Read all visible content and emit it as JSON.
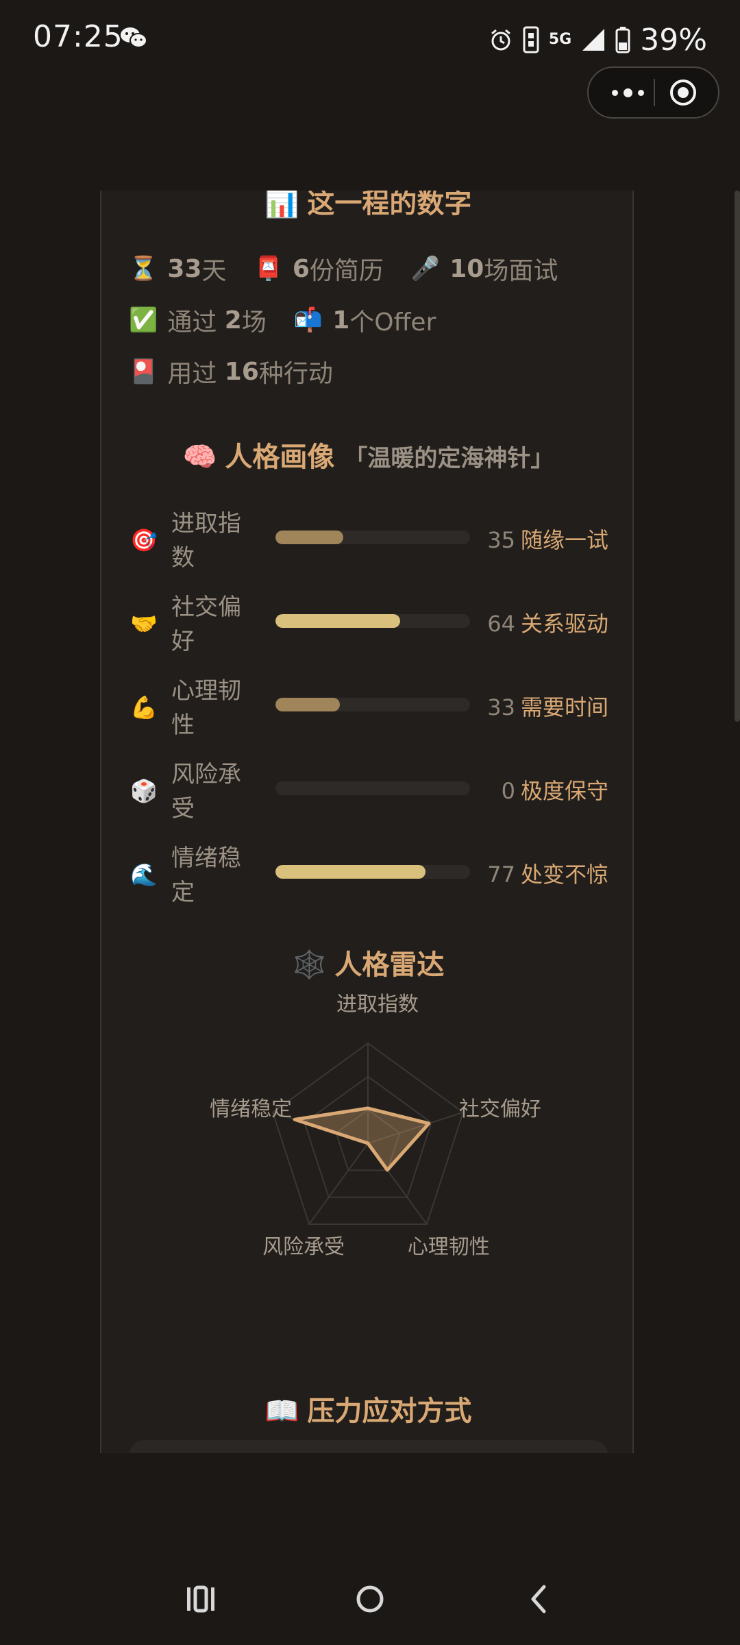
{
  "status_bar": {
    "time": "07:25",
    "network": "5G",
    "battery": "39%"
  },
  "capsule": {
    "more_icon": "more-dots-icon",
    "close_icon": "target-close-icon"
  },
  "stats": {
    "title_emoji": "📊",
    "title": "这一程的数字",
    "items": [
      {
        "emoji": "⏳",
        "value": "33",
        "unit": "天"
      },
      {
        "emoji": "📮",
        "value": "6",
        "unit": "份简历"
      },
      {
        "emoji": "🎤",
        "value": "10",
        "unit": "场面试"
      },
      {
        "emoji": "✅",
        "prefix": "通过 ",
        "value": "2",
        "unit": "场"
      },
      {
        "emoji": "📬",
        "value": "1",
        "unit": "个Offer"
      },
      {
        "emoji": "🎴",
        "prefix": "用过 ",
        "value": "16",
        "unit": "种行动"
      }
    ]
  },
  "persona": {
    "title_emoji": "🧠",
    "title": "人格画像",
    "subtitle": "「温暖的定海神针」",
    "traits": [
      {
        "emoji": "🎯",
        "label": "进取指数",
        "value": 35,
        "value_text": "35",
        "desc": "随缘一试"
      },
      {
        "emoji": "🤝",
        "label": "社交偏好",
        "value": 64,
        "value_text": "64",
        "desc": "关系驱动"
      },
      {
        "emoji": "💪",
        "label": "心理韧性",
        "value": 33,
        "value_text": "33",
        "desc": "需要时间"
      },
      {
        "emoji": "🎲",
        "label": "风险承受",
        "value": 0,
        "value_text": "0",
        "desc": "极度保守"
      },
      {
        "emoji": "🌊",
        "label": "情绪稳定",
        "value": 77,
        "value_text": "77",
        "desc": "处变不惊"
      }
    ]
  },
  "radar": {
    "title_emoji": "🕸️",
    "title": "人格雷达",
    "axes": [
      "进取指数",
      "社交偏好",
      "心理韧性",
      "风险承受",
      "情绪稳定"
    ],
    "values": [
      35,
      64,
      33,
      0,
      77
    ]
  },
  "stress": {
    "title_emoji": "📖",
    "title": "压力应对方式"
  },
  "nav": {
    "recent_icon": "recent-apps-icon",
    "home_icon": "home-icon",
    "back_icon": "back-icon"
  },
  "colors": {
    "accent": "#d9a874",
    "bar_low": "#a0845a",
    "bar_high": "#d9c07c",
    "background": "#1b1816",
    "card": "#211e1b"
  }
}
